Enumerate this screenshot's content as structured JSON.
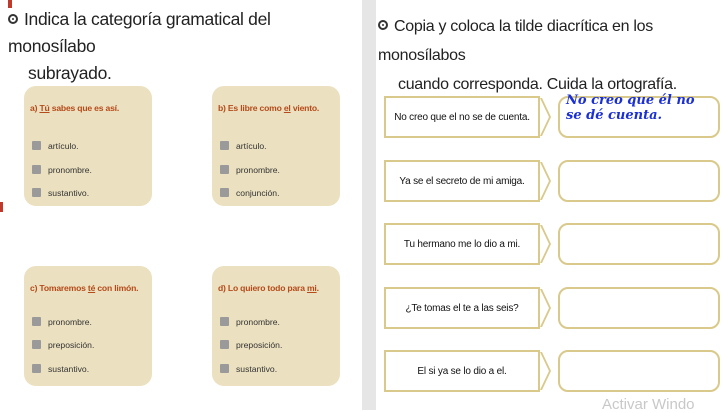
{
  "left": {
    "heading_line1": "Indica la categoría gramatical del monosílabo",
    "heading_line2": "subrayado.",
    "cards": [
      {
        "prefix": "a) ",
        "underlined": "Tú",
        "rest": " sabes que es así.",
        "options": [
          "artículo.",
          "pronombre.",
          "sustantivo."
        ]
      },
      {
        "prefix": "b) Es libre como ",
        "underlined": "el",
        "rest": " viento.",
        "options": [
          "artículo.",
          "pronombre.",
          "conjunción."
        ]
      },
      {
        "prefix": "c) Tomaremos ",
        "underlined": "té",
        "rest": " con limón.",
        "options": [
          "pronombre.",
          "preposición.",
          "sustantivo."
        ]
      },
      {
        "prefix": "d) Lo quiero todo para ",
        "underlined": "mi",
        "rest": ".",
        "options": [
          "pronombre.",
          "preposición.",
          "sustantivo."
        ]
      }
    ]
  },
  "right": {
    "heading_line1": "Copia y coloca la tilde diacrítica en los monosílabos",
    "heading_line2": "cuando corresponda. Cuida la ortografía.",
    "sentences": [
      "No creo que el no se de cuenta.",
      "Ya se el secreto de mi amiga.",
      "Tu hermano me lo dio a mi.",
      "¿Te tomas el te a las seis?",
      "El si ya se lo dio a el."
    ],
    "handwritten_answer": "No creo que él no se dé cuenta."
  },
  "watermark": "Activar Windo",
  "colors": {
    "card_bg": "#ebe0bf",
    "question_text": "#b54a1a",
    "frame_border": "#d9c98a",
    "handwriting": "#1a2fd6"
  }
}
